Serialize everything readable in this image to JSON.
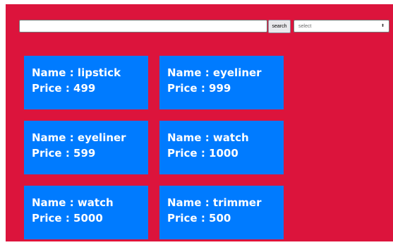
{
  "search": {
    "placeholder": "",
    "value": "",
    "button_label": "search"
  },
  "filter": {
    "selected": "select"
  },
  "products": [
    {
      "name_line": "Name : lipstick",
      "price_line": "Price : 499"
    },
    {
      "name_line": "Name : eyeliner",
      "price_line": "Price : 999"
    },
    {
      "name_line": "Name : eyeliner",
      "price_line": "Price : 599"
    },
    {
      "name_line": "Name : watch",
      "price_line": "Price : 1000"
    },
    {
      "name_line": "Name : watch",
      "price_line": "Price : 5000"
    },
    {
      "name_line": "Name : trimmer",
      "price_line": "Price : 500"
    }
  ],
  "colors": {
    "page_background": "#dc143c",
    "card_background": "#007bff",
    "card_text": "#ffffff"
  },
  "icons": {
    "select_arrow": "chevron-up-down-icon"
  }
}
